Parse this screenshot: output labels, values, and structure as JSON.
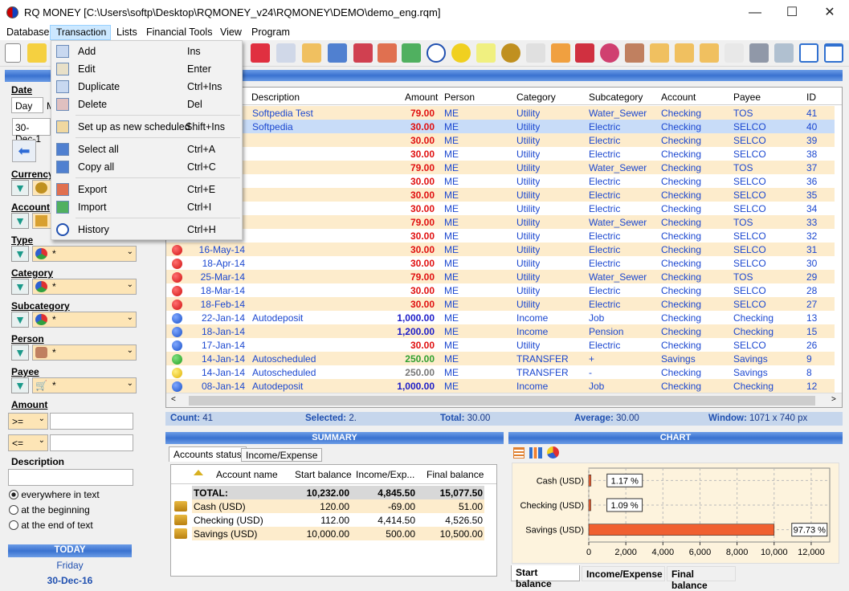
{
  "window": {
    "title": "RQ MONEY [C:\\Users\\softp\\Desktop\\RQMONEY_v24\\RQMONEY\\DEMO\\demo_eng.rqm]",
    "minimize": "—",
    "maximize": "☐",
    "close": "✕"
  },
  "menubar": {
    "items": [
      "Database",
      "Transaction",
      "Lists",
      "Financial Tools",
      "View",
      "Program"
    ]
  },
  "transaction_menu": {
    "items": [
      {
        "label": "Add",
        "shortcut": "Ins",
        "icon": "add-icon"
      },
      {
        "label": "Edit",
        "shortcut": "Enter",
        "icon": "edit-icon"
      },
      {
        "label": "Duplicate",
        "shortcut": "Ctrl+Ins",
        "icon": "duplicate-icon"
      },
      {
        "label": "Delete",
        "shortcut": "Del",
        "icon": "delete-icon"
      },
      {
        "label": "Set up as new scheduled",
        "shortcut": "Shift+Ins",
        "icon": "schedule-icon"
      },
      {
        "label": "Select all",
        "shortcut": "Ctrl+A",
        "icon": "select-all-icon"
      },
      {
        "label": "Copy all",
        "shortcut": "Ctrl+C",
        "icon": "copy-all-icon"
      },
      {
        "label": "Export",
        "shortcut": "Ctrl+E",
        "icon": "export-icon"
      },
      {
        "label": "Import",
        "shortcut": "Ctrl+I",
        "icon": "import-icon"
      },
      {
        "label": "History",
        "shortcut": "Ctrl+H",
        "icon": "history-icon"
      }
    ]
  },
  "filters": {
    "date": {
      "label": "Date",
      "tabs": [
        "Day",
        "M"
      ],
      "value": "30-Dec-1"
    },
    "currency": {
      "label": "Currency",
      "value": "*"
    },
    "account": {
      "label": "Account",
      "value": "*"
    },
    "type": {
      "label": "Type",
      "value": "*"
    },
    "category": {
      "label": "Category",
      "value": "*"
    },
    "subcategory": {
      "label": "Subcategory",
      "value": "*"
    },
    "person": {
      "label": "Person",
      "value": "*"
    },
    "payee": {
      "label": "Payee",
      "value": "*"
    },
    "amount": {
      "label": "Amount",
      "op1": ">=",
      "op2": "<=",
      "v1": "",
      "v2": ""
    },
    "description": {
      "label": "Description",
      "value": "",
      "options": [
        "everywhere in text",
        "at the beginning",
        "at the end of text"
      ]
    },
    "today": {
      "label": "TODAY",
      "weekday": "Friday",
      "date": "30-Dec-16"
    }
  },
  "grid": {
    "columns": [
      "Description",
      "Amount",
      "Person",
      "Category",
      "Subcategory",
      "Account",
      "Payee",
      "ID"
    ],
    "rows": [
      {
        "date": "",
        "desc": "Softpedia Test",
        "amount": "79.00",
        "color": "red",
        "person": "ME",
        "cat": "Utility",
        "sub": "Water_Sewer",
        "acct": "Checking",
        "payee": "TOS",
        "id": "41",
        "dot": ""
      },
      {
        "date": "",
        "desc": "Softpedia",
        "amount": "30.00",
        "color": "red",
        "person": "ME",
        "cat": "Utility",
        "sub": "Electric",
        "acct": "Checking",
        "payee": "SELCO",
        "id": "40",
        "dot": ""
      },
      {
        "date": "",
        "desc": "",
        "amount": "30.00",
        "color": "red",
        "person": "ME",
        "cat": "Utility",
        "sub": "Electric",
        "acct": "Checking",
        "payee": "SELCO",
        "id": "39",
        "dot": ""
      },
      {
        "date": "",
        "desc": "",
        "amount": "30.00",
        "color": "red",
        "person": "ME",
        "cat": "Utility",
        "sub": "Electric",
        "acct": "Checking",
        "payee": "SELCO",
        "id": "38",
        "dot": ""
      },
      {
        "date": "",
        "desc": "",
        "amount": "79.00",
        "color": "red",
        "person": "ME",
        "cat": "Utility",
        "sub": "Water_Sewer",
        "acct": "Checking",
        "payee": "TOS",
        "id": "37",
        "dot": ""
      },
      {
        "date": "",
        "desc": "",
        "amount": "30.00",
        "color": "red",
        "person": "ME",
        "cat": "Utility",
        "sub": "Electric",
        "acct": "Checking",
        "payee": "SELCO",
        "id": "36",
        "dot": ""
      },
      {
        "date": "",
        "desc": "",
        "amount": "30.00",
        "color": "red",
        "person": "ME",
        "cat": "Utility",
        "sub": "Electric",
        "acct": "Checking",
        "payee": "SELCO",
        "id": "35",
        "dot": ""
      },
      {
        "date": "",
        "desc": "",
        "amount": "30.00",
        "color": "red",
        "person": "ME",
        "cat": "Utility",
        "sub": "Electric",
        "acct": "Checking",
        "payee": "SELCO",
        "id": "34",
        "dot": ""
      },
      {
        "date": "",
        "desc": "",
        "amount": "79.00",
        "color": "red",
        "person": "ME",
        "cat": "Utility",
        "sub": "Water_Sewer",
        "acct": "Checking",
        "payee": "TOS",
        "id": "33",
        "dot": ""
      },
      {
        "date": "",
        "desc": "",
        "amount": "30.00",
        "color": "red",
        "person": "ME",
        "cat": "Utility",
        "sub": "Electric",
        "acct": "Checking",
        "payee": "SELCO",
        "id": "32",
        "dot": ""
      },
      {
        "date": "16-May-14",
        "desc": "",
        "amount": "30.00",
        "color": "red",
        "person": "ME",
        "cat": "Utility",
        "sub": "Electric",
        "acct": "Checking",
        "payee": "SELCO",
        "id": "31",
        "dot": "red"
      },
      {
        "date": "18-Apr-14",
        "desc": "",
        "amount": "30.00",
        "color": "red",
        "person": "ME",
        "cat": "Utility",
        "sub": "Electric",
        "acct": "Checking",
        "payee": "SELCO",
        "id": "30",
        "dot": "red"
      },
      {
        "date": "25-Mar-14",
        "desc": "",
        "amount": "79.00",
        "color": "red",
        "person": "ME",
        "cat": "Utility",
        "sub": "Water_Sewer",
        "acct": "Checking",
        "payee": "TOS",
        "id": "29",
        "dot": "red"
      },
      {
        "date": "18-Mar-14",
        "desc": "",
        "amount": "30.00",
        "color": "red",
        "person": "ME",
        "cat": "Utility",
        "sub": "Electric",
        "acct": "Checking",
        "payee": "SELCO",
        "id": "28",
        "dot": "red"
      },
      {
        "date": "18-Feb-14",
        "desc": "",
        "amount": "30.00",
        "color": "red",
        "person": "ME",
        "cat": "Utility",
        "sub": "Electric",
        "acct": "Checking",
        "payee": "SELCO",
        "id": "27",
        "dot": "red"
      },
      {
        "date": "22-Jan-14",
        "desc": "Autodeposit",
        "amount": "1,000.00",
        "color": "blue",
        "person": "ME",
        "cat": "Income",
        "sub": "Job",
        "acct": "Checking",
        "payee": "Checking",
        "id": "13",
        "dot": "blue"
      },
      {
        "date": "18-Jan-14",
        "desc": "",
        "amount": "1,200.00",
        "color": "blue",
        "person": "ME",
        "cat": "Income",
        "sub": "Pension",
        "acct": "Checking",
        "payee": "Checking",
        "id": "15",
        "dot": "blue"
      },
      {
        "date": "17-Jan-14",
        "desc": "",
        "amount": "30.00",
        "color": "red",
        "person": "ME",
        "cat": "Utility",
        "sub": "Electric",
        "acct": "Checking",
        "payee": "SELCO",
        "id": "26",
        "dot": "blue"
      },
      {
        "date": "14-Jan-14",
        "desc": "Autoscheduled",
        "amount": "250.00",
        "color": "green",
        "person": "ME",
        "cat": "TRANSFER",
        "sub": "+",
        "acct": "Savings",
        "payee": "Savings",
        "id": "9",
        "dot": "green"
      },
      {
        "date": "14-Jan-14",
        "desc": "Autoscheduled",
        "amount": "250.00",
        "color": "gray",
        "person": "ME",
        "cat": "TRANSFER",
        "sub": "-",
        "acct": "Checking",
        "payee": "Savings",
        "id": "8",
        "dot": "yellow"
      },
      {
        "date": "08-Jan-14",
        "desc": "Autodeposit",
        "amount": "1,000.00",
        "color": "blue",
        "person": "ME",
        "cat": "Income",
        "sub": "Job",
        "acct": "Checking",
        "payee": "Checking",
        "id": "12",
        "dot": "blue"
      }
    ]
  },
  "status": {
    "count_label": "Count:",
    "count": "41",
    "selected_label": "Selected:",
    "selected": "2.",
    "total_label": "Total:",
    "total": "30.00",
    "average_label": "Average:",
    "average": "30.00",
    "window_label": "Window:",
    "window": "1071 x 740 px"
  },
  "summary": {
    "title": "SUMMARY",
    "tabs": [
      "Accounts status",
      "Income/Expense"
    ],
    "columns": [
      "Account name",
      "Start balance",
      "Income/Exp...",
      "Final balance"
    ],
    "total": {
      "name": "TOTAL:",
      "start": "10,232.00",
      "inc": "4,845.50",
      "final": "15,077.50"
    },
    "rows": [
      {
        "name": "Cash (USD)",
        "start": "120.00",
        "inc": "-69.00",
        "final": "51.00"
      },
      {
        "name": "Checking (USD)",
        "start": "112.00",
        "inc": "4,414.50",
        "final": "4,526.50"
      },
      {
        "name": "Savings (USD)",
        "start": "10,000.00",
        "inc": "500.00",
        "final": "10,500.00"
      }
    ]
  },
  "chart_panel": {
    "title": "CHART",
    "tabs": [
      "Start balance",
      "Income/Expense",
      "Final balance"
    ]
  },
  "chart_data": {
    "type": "bar",
    "orientation": "horizontal",
    "categories": [
      "Cash (USD)",
      "Checking (USD)",
      "Savings (USD)"
    ],
    "values": [
      120,
      112,
      10000
    ],
    "data_labels": [
      "1.17 %",
      "1.09 %",
      "97.73 %"
    ],
    "xlim": [
      0,
      13000
    ],
    "xticks": [
      "0",
      "2,000",
      "4,000",
      "6,000",
      "8,000",
      "10,000",
      "12,000"
    ],
    "bar_color": "#f06030"
  }
}
